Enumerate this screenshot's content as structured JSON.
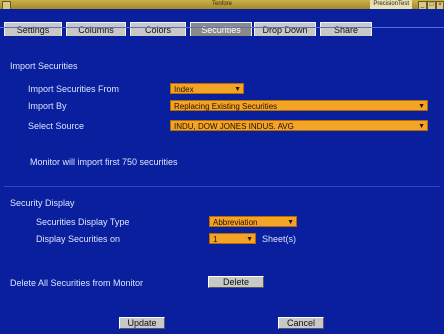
{
  "window": {
    "title": "Tenfore",
    "right_label": "PrecisionTest",
    "buttons": [
      "_",
      "□",
      "×"
    ]
  },
  "tabs": [
    {
      "label": "Settings"
    },
    {
      "label": "Columns"
    },
    {
      "label": "Colors"
    },
    {
      "label": "Securities",
      "active": true
    },
    {
      "label": "Drop Down"
    },
    {
      "label": "Share"
    }
  ],
  "import": {
    "heading": "Import Securities",
    "from_label": "Import Securities From",
    "from_value": "Index",
    "by_label": "Import By",
    "by_value": "Replacing Existing Securities",
    "source_label": "Select Source",
    "source_value": "INDU, DOW JONES INDUS. AVG",
    "note": "Monitor will import first 750 securities"
  },
  "display": {
    "heading": "Security Display",
    "type_label": "Securities Display Type",
    "type_value": "Abbreviation",
    "display_on_label": "Display Securities on",
    "display_on_value": "1",
    "sheets_label": "Sheet(s)"
  },
  "delete": {
    "label": "Delete All Securities from Monitor",
    "button": "Delete"
  },
  "footer": {
    "update": "Update",
    "cancel": "Cancel"
  },
  "colors": {
    "background": "#0a1f9e",
    "field": "#f3a427",
    "button": "#c8c8c8"
  }
}
